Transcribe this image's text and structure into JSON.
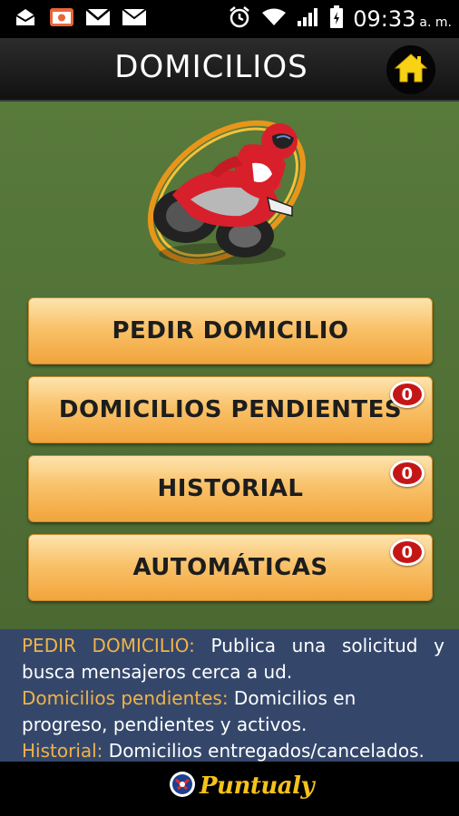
{
  "status_bar": {
    "time": "09:33",
    "ampm": "a. m.",
    "icons": [
      "envelope-down-icon",
      "camera-icon",
      "gmail-icon",
      "mail-icon",
      "alarm-icon",
      "wifi-icon",
      "signal-icon",
      "battery-icon"
    ]
  },
  "header": {
    "title": "DOMICILIOS",
    "home_icon": "home-icon"
  },
  "menu": [
    {
      "label": "PEDIR DOMICILIO",
      "badge": null
    },
    {
      "label": "DOMICILIOS PENDIENTES",
      "badge": "0"
    },
    {
      "label": "HISTORIAL",
      "badge": "0"
    },
    {
      "label": "AUTOMÁTICAS",
      "badge": "0"
    }
  ],
  "description": {
    "items": [
      {
        "key": "PEDIR DOMICILIO:",
        "text": " Publica una solicitud y busca mensajeros cerca a ud."
      },
      {
        "key": "Domicilios pendientes:",
        "text": " Domicilios en progreso, pendientes y activos."
      },
      {
        "key": "Historial:",
        "text": " Domicilios entregados/cancelados."
      }
    ]
  },
  "footer": {
    "brand": "Puntualy"
  },
  "colors": {
    "accent_orange": "#f2a43b",
    "key_text": "#f0b24a",
    "main_bg": "#4f6b35",
    "desc_bg": "#34476b",
    "badge_red": "#c51616",
    "brand_yellow": "#f6c21b"
  }
}
